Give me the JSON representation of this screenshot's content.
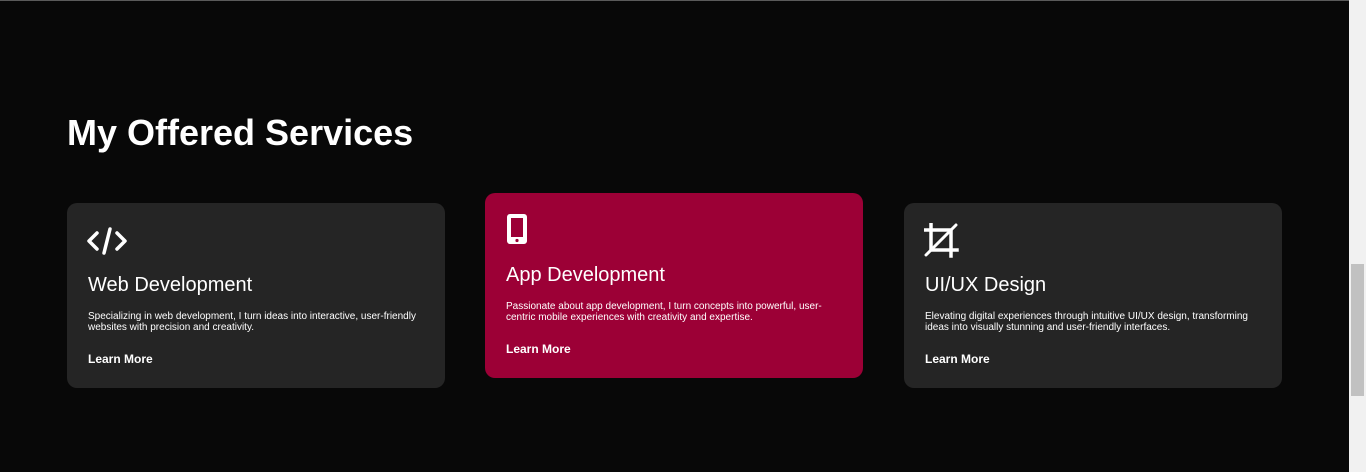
{
  "section": {
    "title": "My Offered Services"
  },
  "services": [
    {
      "icon": "code-icon",
      "title": "Web Development",
      "description": "Specializing in web development, I turn ideas into interactive, user-friendly websites with precision and creativity.",
      "link": "Learn More"
    },
    {
      "icon": "mobile-phone-icon",
      "title": "App Development",
      "description": "Passionate about app development, I turn concepts into powerful, user-centric mobile experiences with creativity and expertise.",
      "link": "Learn More"
    },
    {
      "icon": "crop-icon",
      "title": "UI/UX Design",
      "description": "Elevating digital experiences through intuitive UI/UX design, transforming ideas into visually stunning and user-friendly interfaces.",
      "link": "Learn More"
    }
  ],
  "colors": {
    "background": "#080808",
    "card": "#252525",
    "card_active": "#9c0036",
    "text": "#ffffff"
  }
}
